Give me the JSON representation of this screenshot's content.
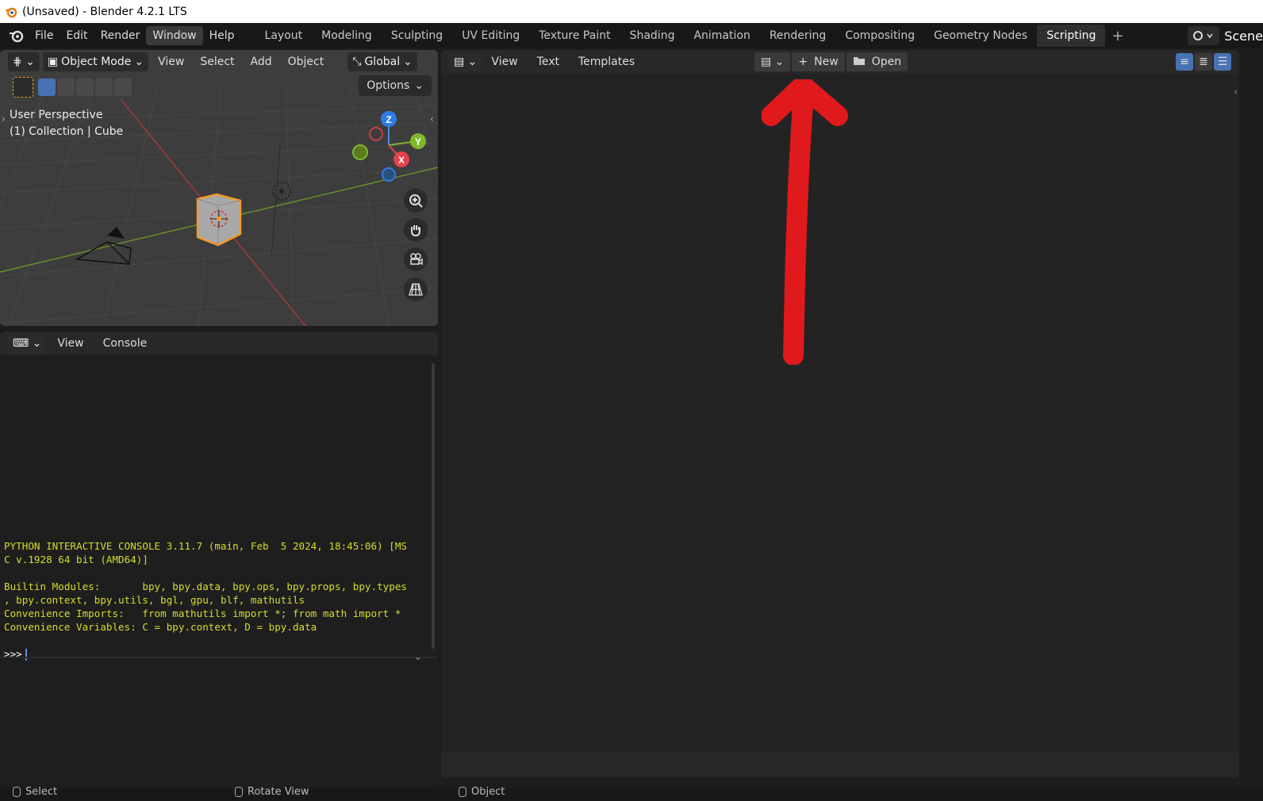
{
  "titlebar": {
    "title": "(Unsaved) - Blender 4.2.1 LTS"
  },
  "menu": [
    "File",
    "Edit",
    "Render",
    "Window",
    "Help"
  ],
  "menu_active": "Window",
  "workspaces": [
    "Layout",
    "Modeling",
    "Sculpting",
    "UV Editing",
    "Texture Paint",
    "Shading",
    "Animation",
    "Rendering",
    "Compositing",
    "Geometry Nodes",
    "Scripting"
  ],
  "workspace_active": "Scripting",
  "scene": {
    "name": "Scene"
  },
  "viewport": {
    "mode": "Object Mode",
    "menu": [
      "View",
      "Select",
      "Add",
      "Object"
    ],
    "orientation": "Global",
    "options": "Options",
    "info_line1": "User Perspective",
    "info_line2": "(1) Collection | Cube",
    "gizmo": {
      "z": "Z",
      "y": "Y",
      "x": "X"
    }
  },
  "console": {
    "menu": [
      "View",
      "Console"
    ],
    "lines": [
      "PYTHON INTERACTIVE CONSOLE 3.11.7 (main, Feb  5 2024, 18:45:06) [MS",
      "C v.1928 64 bit (AMD64)]",
      "",
      "Builtin Modules:       bpy, bpy.data, bpy.ops, bpy.props, bpy.types",
      ", bpy.context, bpy.utils, bgl, gpu, blf, mathutils",
      "Convenience Imports:   from mathutils import *; from math import *",
      "Convenience Variables: C = bpy.context, D = bpy.data"
    ],
    "prompt": ">>>"
  },
  "text_editor": {
    "menu": [
      "View",
      "Text",
      "Templates"
    ],
    "new_label": "New",
    "open_label": "Open"
  },
  "statusbar": {
    "items": [
      "Select",
      "Rotate View",
      "Object"
    ]
  },
  "colors": {
    "accent": "#4772b3",
    "selection": "#e99b2f",
    "annotation_arrow": "#e0191c",
    "console_text": "#d4dd2a"
  }
}
